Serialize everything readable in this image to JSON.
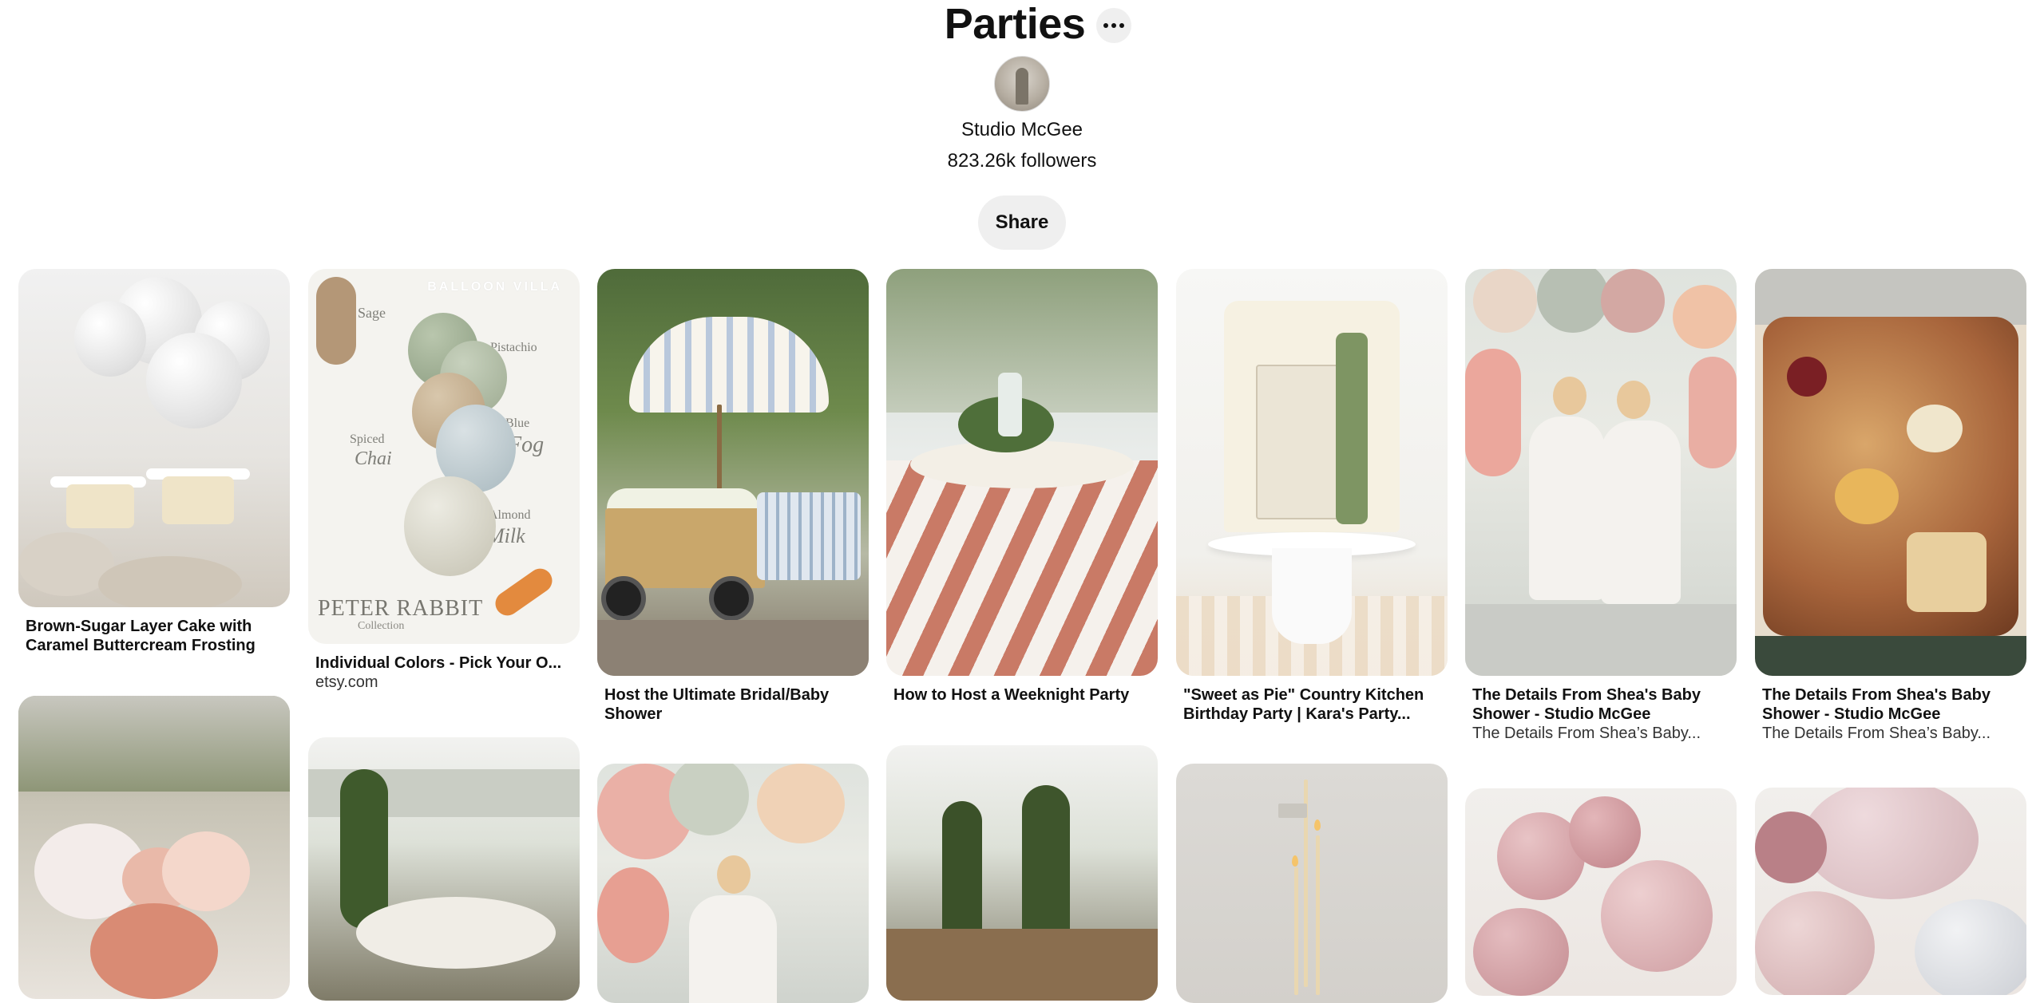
{
  "board": {
    "title": "Parties",
    "owner": "Studio McGee",
    "followers": "823.26k followers",
    "share_label": "Share"
  },
  "pins": [
    {
      "title": "Brown-Sugar Layer Cake with Caramel Buttercream Frosting",
      "subtitle": ""
    },
    {
      "title": "Individual Colors - Pick Your O...",
      "subtitle": "etsy.com",
      "image_text": {
        "brand": "BALLOON VILLA",
        "sage": "Sage",
        "pistachio": "Pistachio",
        "spiced": "Spiced",
        "chai": "Chai",
        "blue": "Blue",
        "fog": "Fog",
        "almond": "Almond",
        "milk": "Milk",
        "logo": "PETER RABBIT",
        "logo_sub": "Collection"
      }
    },
    {
      "title": "Host the Ultimate Bridal/Baby Shower",
      "subtitle": ""
    },
    {
      "title": "How to Host a Weeknight Party",
      "subtitle": ""
    },
    {
      "title": "\"Sweet as Pie\" Country Kitchen Birthday Party | Kara's Party...",
      "subtitle": ""
    },
    {
      "title": "The Details From Shea's Baby Shower - Studio McGee",
      "subtitle": "The Details From Shea’s Baby..."
    },
    {
      "title": "The Details From Shea's Baby Shower - Studio McGee",
      "subtitle": "The Details From Shea’s Baby..."
    }
  ]
}
